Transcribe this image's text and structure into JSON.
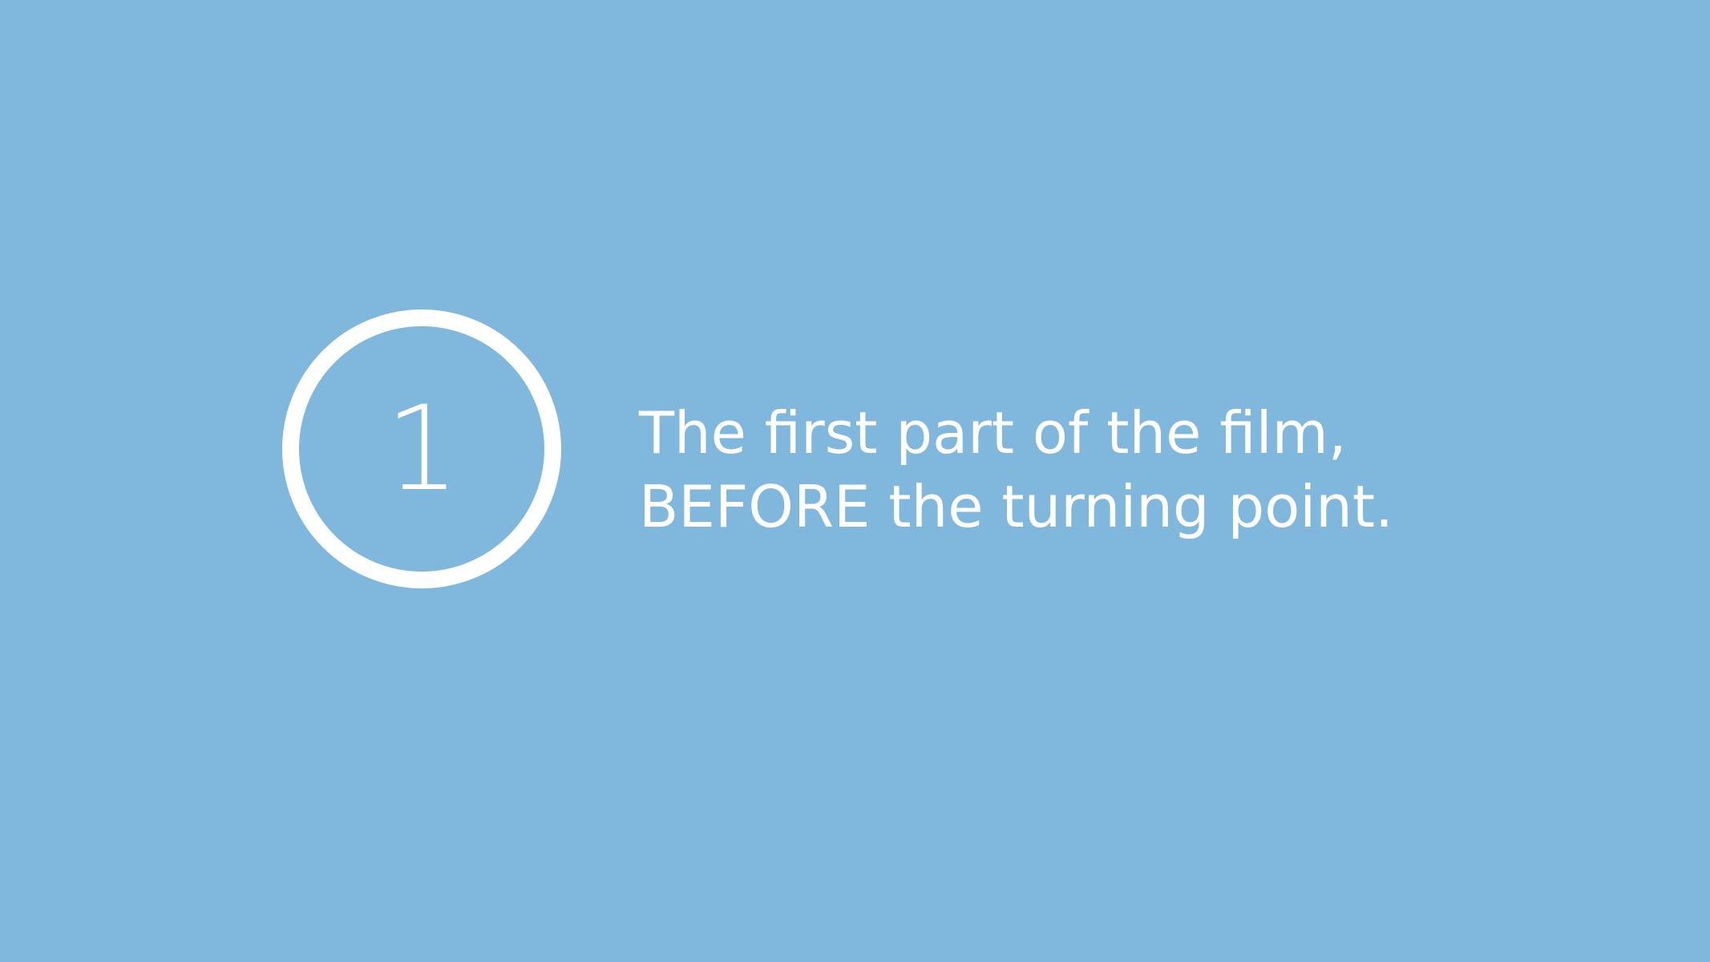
{
  "slide": {
    "step_number": "1",
    "lines": [
      "The first part of the film,",
      "BEFORE the turning point."
    ]
  },
  "colors": {
    "background": "#80b7dc",
    "foreground": "#ffffff"
  }
}
